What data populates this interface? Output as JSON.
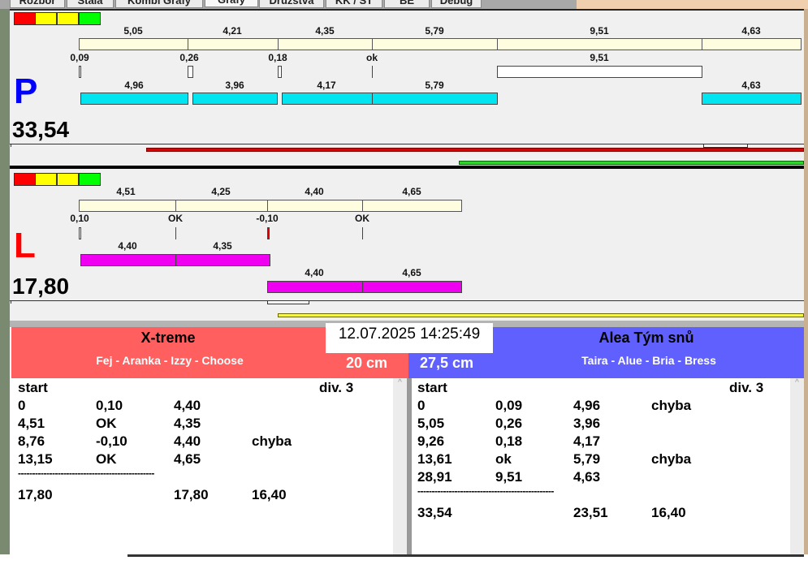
{
  "tabs": [
    "Rozbor",
    "Stala",
    "Kombi Grafy",
    "Grafy",
    "Družstva",
    "KK / ST",
    "BE",
    "Debug"
  ],
  "active_tab": "Grafy",
  "status_colors": [
    "#ff0000",
    "#ffff00",
    "#ffff00",
    "#00ff00"
  ],
  "p": {
    "letter": "P",
    "letter_color": "#0000ff",
    "score": "33,54",
    "top_values": [
      "5,05",
      "4,21",
      "4,35",
      "5,79",
      "9,51",
      "4,63"
    ],
    "diff_values": [
      "0,09",
      "0,26",
      "0,18",
      "ok",
      "9,51"
    ],
    "bar_values": [
      "4,96",
      "3,96",
      "4,17",
      "5,79",
      "4,63"
    ]
  },
  "l": {
    "letter": "L",
    "letter_color": "#ff0000",
    "score": "17,80",
    "top_values": [
      "4,51",
      "4,25",
      "4,40",
      "4,65"
    ],
    "diff_values": [
      "0,10",
      "OK",
      "-0,10",
      "OK"
    ],
    "bar_values": [
      "4,40",
      "4,35"
    ],
    "bar2_values": [
      "4,40",
      "4,65"
    ]
  },
  "datetime": "12.07.2025 14:25:49",
  "left_team": {
    "name": "X-treme",
    "members": "Fej - Aranka - Izzy - Choose",
    "distance": "20 cm",
    "color": "#ff5f5f",
    "header": [
      "start",
      "div.  3"
    ],
    "rows": [
      [
        "0",
        "0,10",
        "4,40",
        ""
      ],
      [
        "4,51",
        "OK",
        "4,35",
        ""
      ],
      [
        "8,76",
        "-0,10",
        "4,40",
        "chyba"
      ],
      [
        "13,15",
        "OK",
        "4,65",
        ""
      ]
    ],
    "separator": "------------------------------------------------",
    "total": [
      "17,80",
      "",
      "17,80",
      "16,40"
    ]
  },
  "right_team": {
    "name": "Alea Tým snů",
    "members": "Taira - Alue - Bria - Bress",
    "distance": "27,5 cm",
    "color": "#6060ff",
    "header": [
      "start",
      "div.  3"
    ],
    "rows": [
      [
        "0",
        "0,09",
        "4,96",
        "chyba"
      ],
      [
        "5,05",
        "0,26",
        "3,96",
        ""
      ],
      [
        "9,26",
        "0,18",
        "4,17",
        ""
      ],
      [
        "13,61",
        "ok",
        "5,79",
        "chyba"
      ],
      [
        "28,91",
        "9,51",
        "4,63",
        ""
      ]
    ],
    "separator": "------------------------------------------------",
    "total": [
      "33,54",
      "",
      "23,51",
      "16,40"
    ]
  }
}
